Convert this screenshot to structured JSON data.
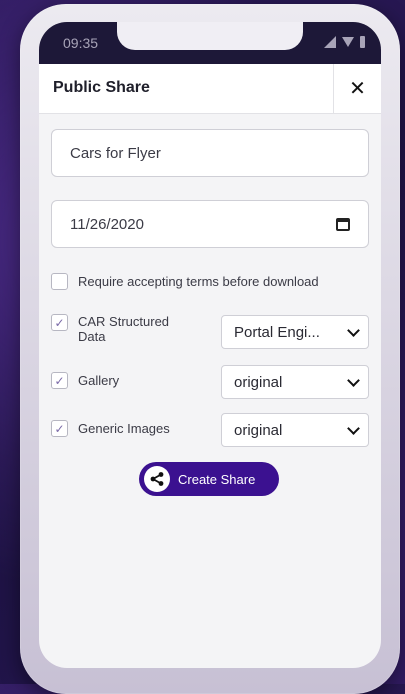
{
  "status": {
    "time": "09:35"
  },
  "header": {
    "title": "Public Share",
    "close_label": "✕"
  },
  "form": {
    "name_value": "Cars for Flyer",
    "date_value": "11/26/2020",
    "terms": {
      "label": "Require accepting terms before download",
      "checked": false
    },
    "options": [
      {
        "label": "CAR Structured Data",
        "checked": true,
        "select_value": "Portal Engi..."
      },
      {
        "label": "Gallery",
        "checked": true,
        "select_value": "original"
      },
      {
        "label": "Generic Images",
        "checked": true,
        "select_value": "original"
      }
    ],
    "check_mark": "✓"
  },
  "actions": {
    "create_label": "Create Share"
  },
  "colors": {
    "accent": "#3b1190",
    "status_bar": "#1d1838"
  }
}
